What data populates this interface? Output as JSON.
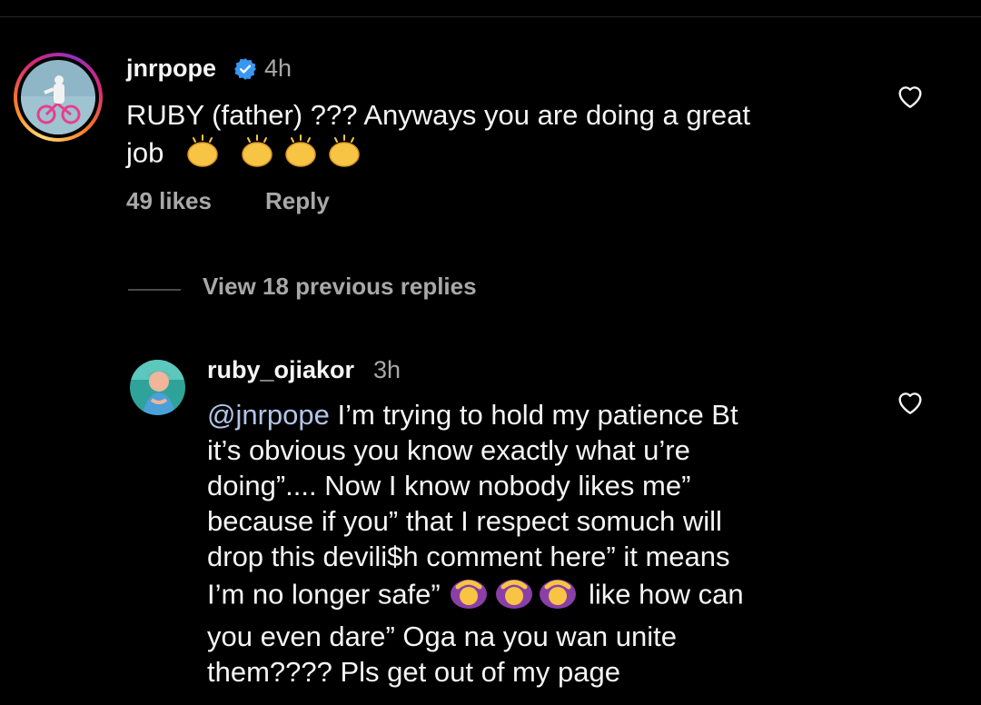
{
  "comment": {
    "username": "jnrpope",
    "time": "4h",
    "text_line1": "RUBY (father) ??? Anyways you are doing a great",
    "text_line2": "job",
    "emoji": "clapping-hands",
    "likes": "49 likes",
    "reply_label": "Reply"
  },
  "view_replies": "View 18 previous replies",
  "reply": {
    "username": "ruby_ojiakor",
    "time": "3h",
    "mention": "@jnrpope",
    "line1": " I’m trying to hold my patience Bt",
    "line2": "it’s obvious you know exactly what u’re",
    "line3": "doing”.... Now I know nobody likes me”",
    "line4": "because if you” that I respect somuch will",
    "line5": "drop this devili$h comment here” it means",
    "line6a": "I’m no longer safe”",
    "line6b": " like how can",
    "line7": "you even dare” Oga na you wan unite",
    "line8": "them???? Pls get out of my page",
    "emoji": "woman-gesturing-ok"
  },
  "colors": {
    "background": "#000000",
    "text": "#f5f5f5",
    "secondary": "#a8a8a8",
    "verified": "#3897f0",
    "mention": "#b3c4e6"
  }
}
